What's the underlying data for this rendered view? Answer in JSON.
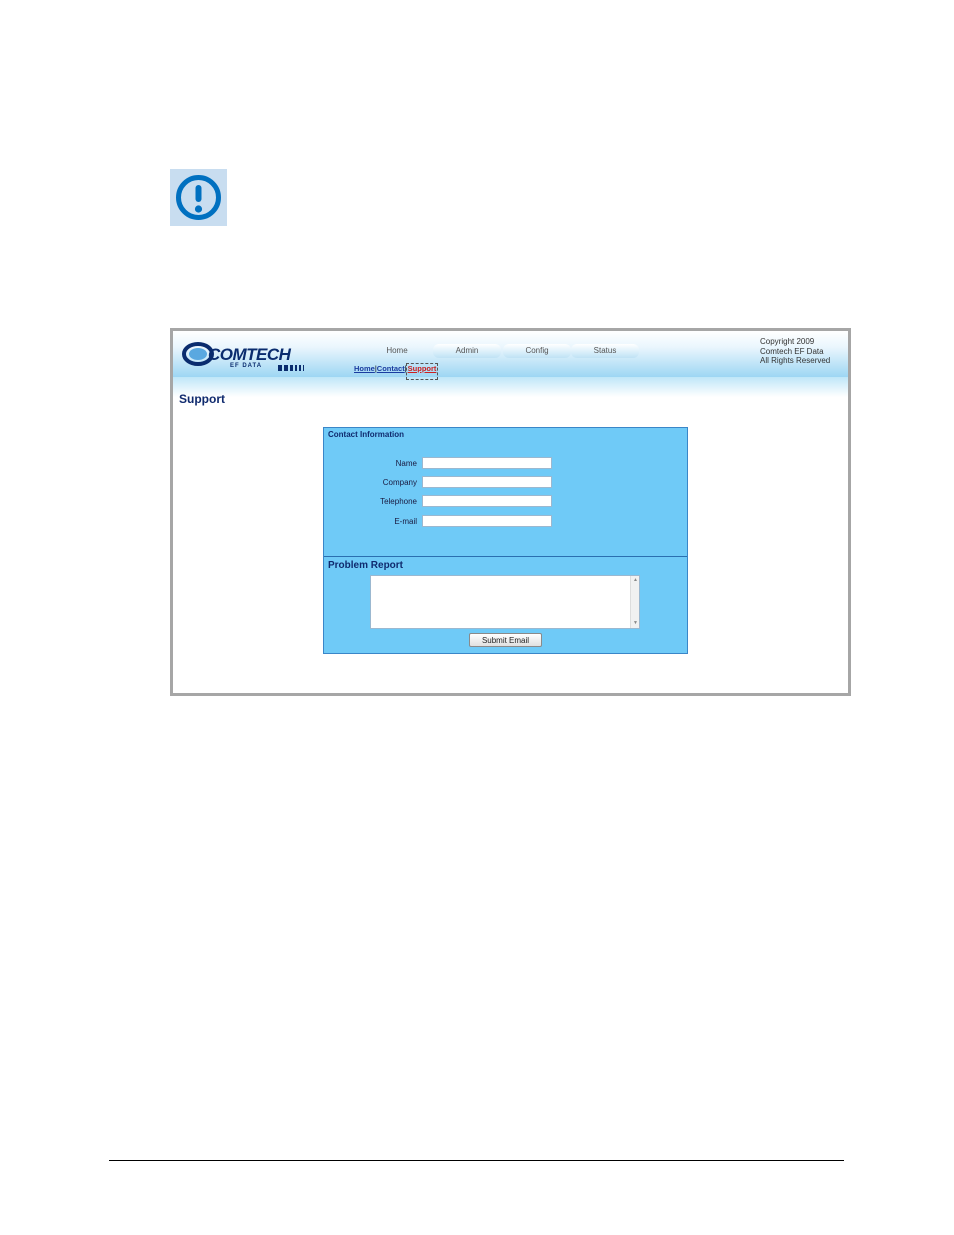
{
  "caution_icon": "exclamation-circle-icon",
  "logo": {
    "name": "COMTECH",
    "sub": "EF DATA"
  },
  "nav": {
    "tabs": [
      {
        "label": "Home"
      },
      {
        "label": "Admin"
      },
      {
        "label": "Config"
      },
      {
        "label": "Status"
      }
    ]
  },
  "copyright": {
    "line1": "Copyright 2009",
    "line2": "Comtech EF Data",
    "line3": "All Rights Reserved"
  },
  "subnav": {
    "home": "Home",
    "sep1": "|",
    "contact": "Contact",
    "sep2": "|",
    "support": "Support"
  },
  "page": {
    "title": "Support"
  },
  "contact_section": {
    "title": "Contact Information",
    "fields": [
      {
        "label": "Name",
        "value": ""
      },
      {
        "label": "Company",
        "value": ""
      },
      {
        "label": "Telephone",
        "value": ""
      },
      {
        "label": "E-mail",
        "value": ""
      }
    ]
  },
  "report_section": {
    "title": "Problem Report",
    "value": "",
    "submit_label": "Submit Email"
  },
  "colors": {
    "panel": "#6fcaf7",
    "title": "#0f2a6e",
    "link": "#1a3ca0",
    "active_link": "#cc2020"
  }
}
